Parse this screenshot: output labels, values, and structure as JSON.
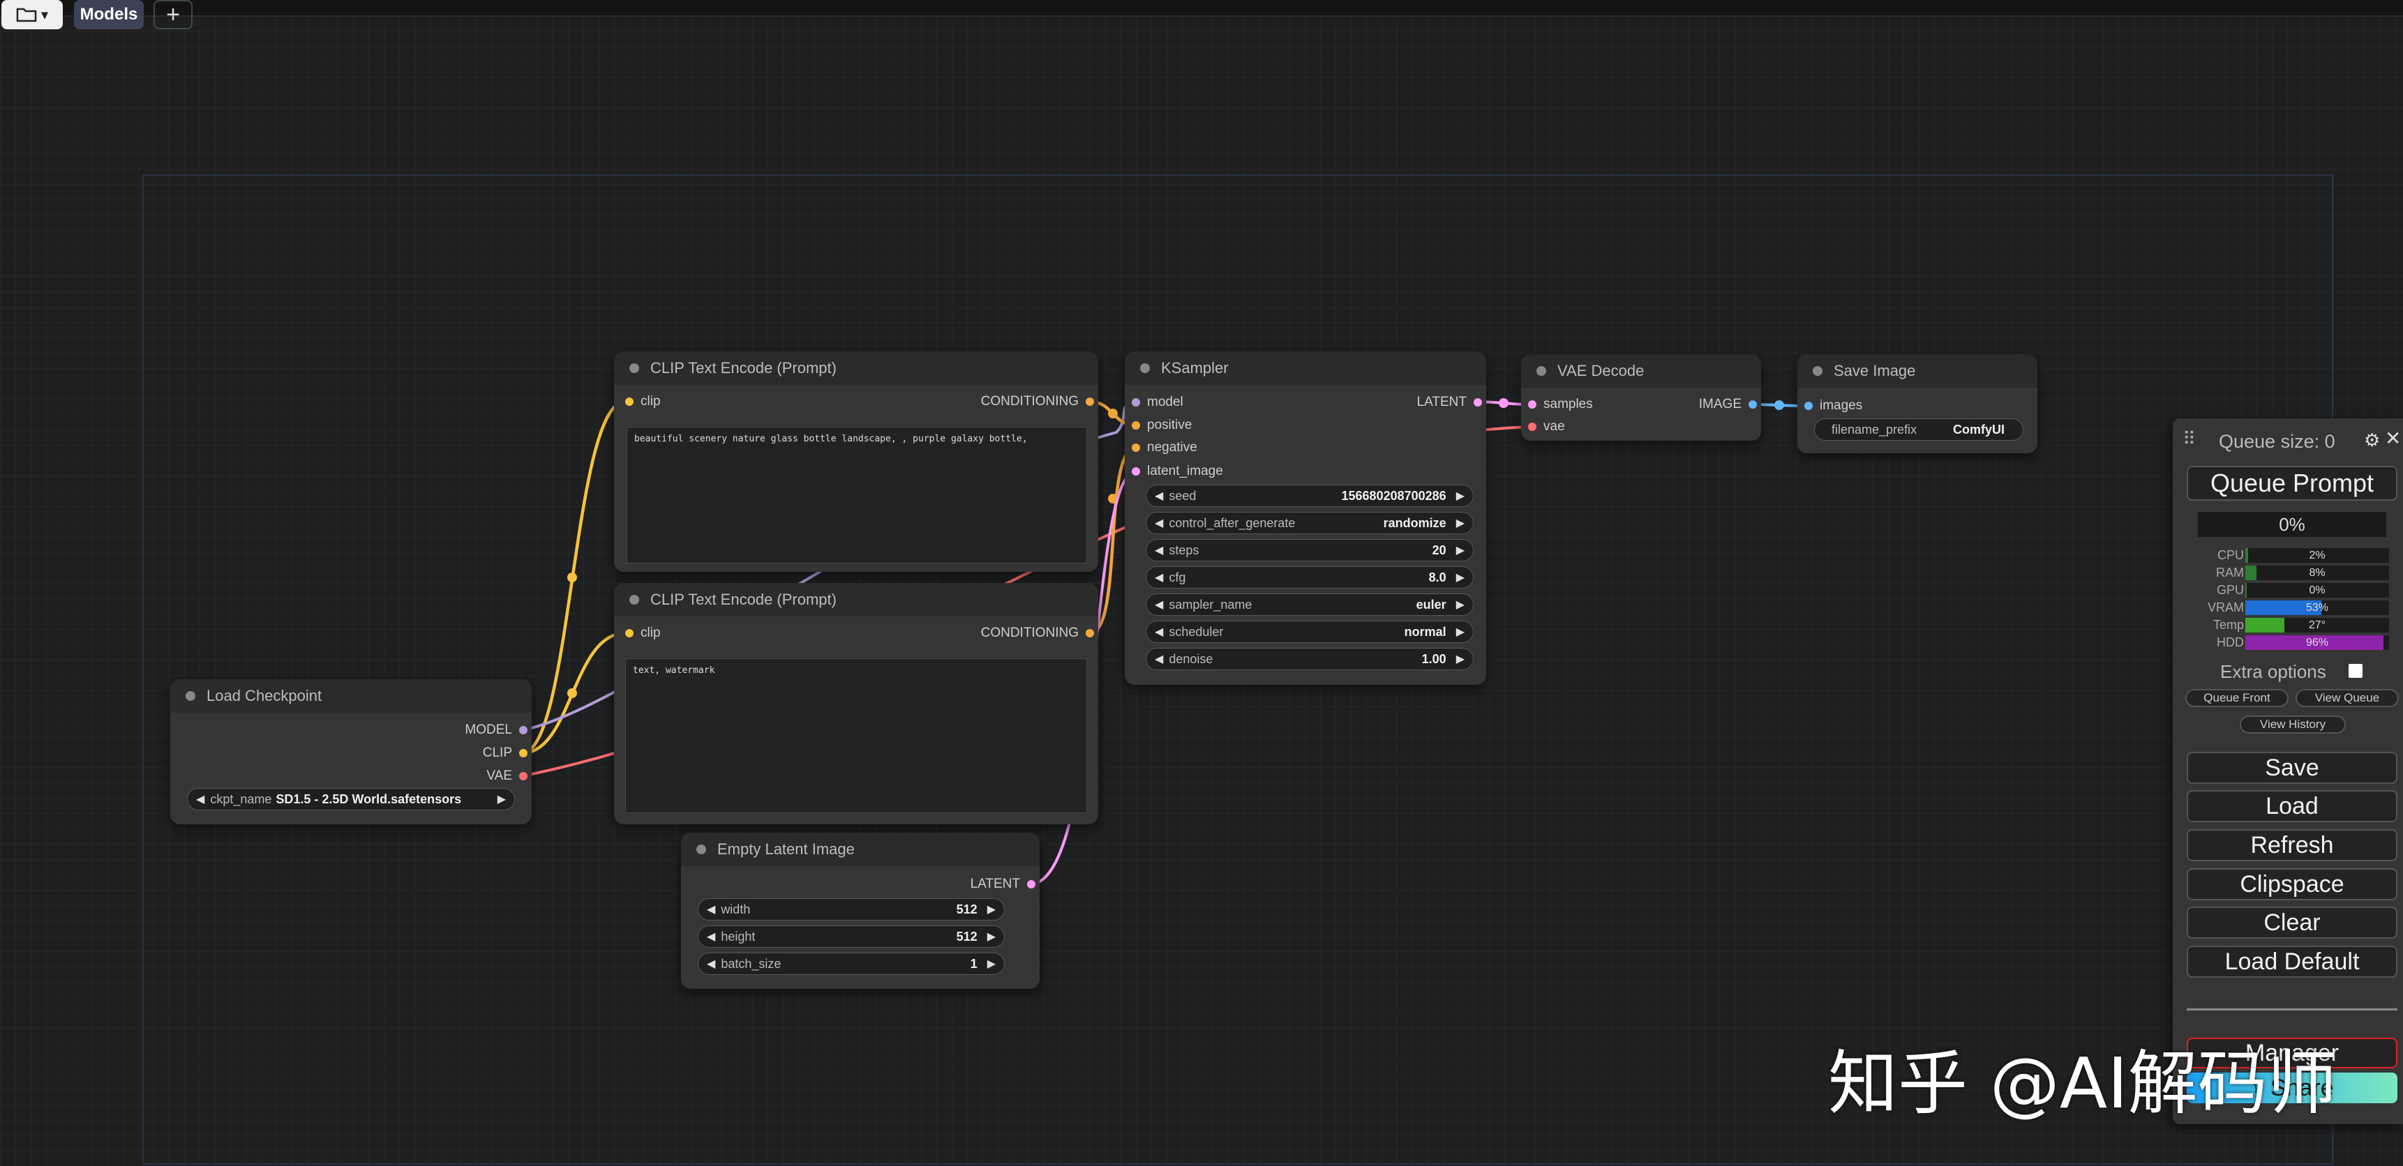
{
  "topbar": {
    "folder_icon": "folder-icon",
    "folder_caret": "▾",
    "models_label": "Models",
    "add_label": "+"
  },
  "colors": {
    "clip": "#f7c33c",
    "conditioning": "#f5a93a",
    "model": "#b39ddb",
    "vae": "#ff6e6e",
    "latent": "#ff9cf9",
    "image": "#64b5f6"
  },
  "nodes": {
    "clip_pos": {
      "title": "CLIP Text Encode (Prompt)",
      "in_clip": "clip",
      "out_conditioning": "CONDITIONING",
      "text": "beautiful scenery nature glass bottle landscape, , purple galaxy bottle,"
    },
    "clip_neg": {
      "title": "CLIP Text Encode (Prompt)",
      "in_clip": "clip",
      "out_conditioning": "CONDITIONING",
      "text": "text, watermark"
    },
    "ksampler": {
      "title": "KSampler",
      "in_model": "model",
      "in_positive": "positive",
      "in_negative": "negative",
      "in_latent": "latent_image",
      "out_latent": "LATENT",
      "widgets": [
        {
          "name": "seed",
          "value": "156680208700286"
        },
        {
          "name": "control_after_generate",
          "value": "randomize"
        },
        {
          "name": "steps",
          "value": "20"
        },
        {
          "name": "cfg",
          "value": "8.0"
        },
        {
          "name": "sampler_name",
          "value": "euler"
        },
        {
          "name": "scheduler",
          "value": "normal"
        },
        {
          "name": "denoise",
          "value": "1.00"
        }
      ]
    },
    "vae_decode": {
      "title": "VAE Decode",
      "in_samples": "samples",
      "in_vae": "vae",
      "out_image": "IMAGE"
    },
    "save_image": {
      "title": "Save Image",
      "in_images": "images",
      "widget_name": "filename_prefix",
      "widget_value": "ComfyUI"
    },
    "load_checkpoint": {
      "title": "Load Checkpoint",
      "out_model": "MODEL",
      "out_clip": "CLIP",
      "out_vae": "VAE",
      "widget_name": "ckpt_name",
      "widget_value": "SD1.5 - 2.5D World.safetensors"
    },
    "empty_latent": {
      "title": "Empty Latent Image",
      "out_latent": "LATENT",
      "widgets": [
        {
          "name": "width",
          "value": "512"
        },
        {
          "name": "height",
          "value": "512"
        },
        {
          "name": "batch_size",
          "value": "1"
        }
      ]
    }
  },
  "panel": {
    "queue_size": "Queue size: 0",
    "queue_prompt": "Queue Prompt",
    "progress": "0%",
    "monitors": [
      {
        "label": "CPU",
        "value": "2%",
        "percent": 2,
        "color": "#2e7d32"
      },
      {
        "label": "RAM",
        "value": "8%",
        "percent": 8,
        "color": "#2e7d32"
      },
      {
        "label": "GPU",
        "value": "0%",
        "percent": 0,
        "color": "#2e7d32"
      },
      {
        "label": "VRAM",
        "value": "53%",
        "percent": 53,
        "color": "#1e6fd6"
      },
      {
        "label": "Temp",
        "value": "27°",
        "percent": 27,
        "color": "#3da82a"
      },
      {
        "label": "HDD",
        "value": "96%",
        "percent": 96,
        "color": "#8e24aa"
      }
    ],
    "extra_options": "Extra options",
    "queue_front": "Queue Front",
    "view_queue": "View Queue",
    "view_history": "View History",
    "save": "Save",
    "load": "Load",
    "refresh": "Refresh",
    "clipspace": "Clipspace",
    "clear": "Clear",
    "load_default": "Load Default",
    "manager": "Manager",
    "share": "Share"
  },
  "watermark": "知乎 @AI解码师"
}
